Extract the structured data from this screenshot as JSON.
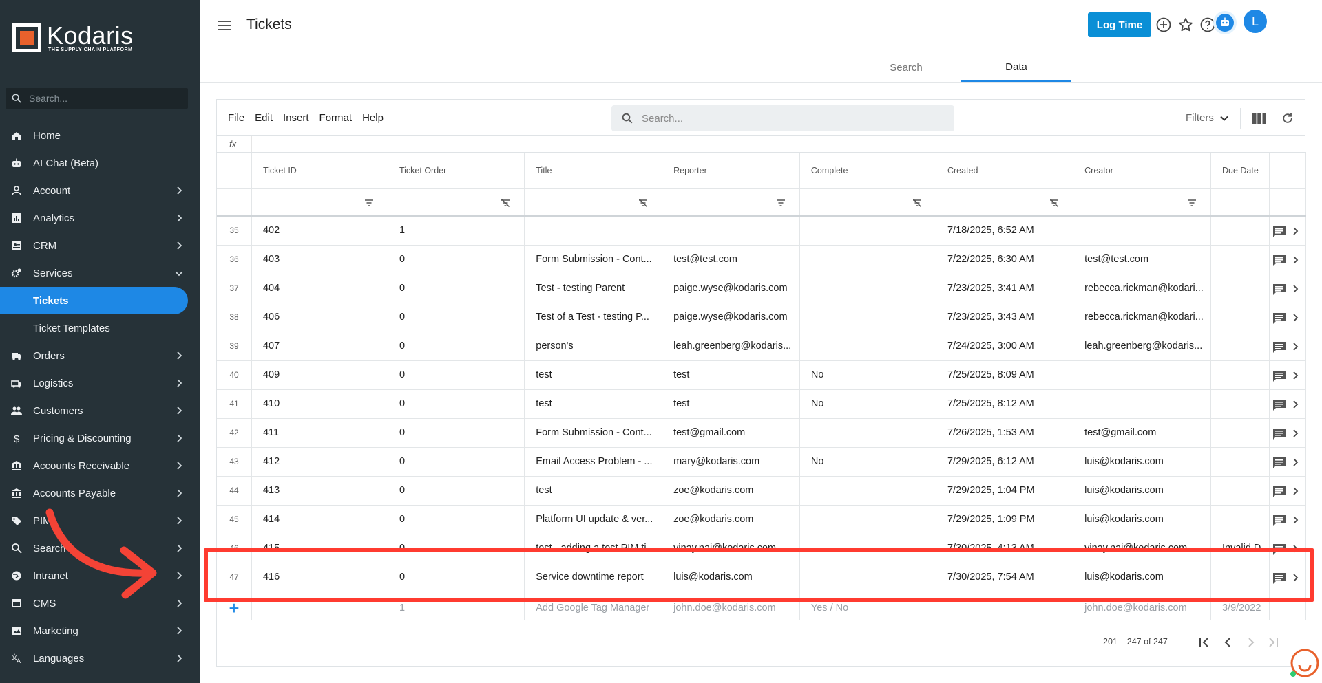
{
  "brand": {
    "name": "Kodaris",
    "tagline": "THE SUPPLY CHAIN PLATFORM"
  },
  "sidebar": {
    "search_placeholder": "Search...",
    "items": [
      {
        "label": "Home",
        "icon": "home-icon"
      },
      {
        "label": "AI Chat (Beta)",
        "icon": "robot-icon"
      },
      {
        "label": "Account",
        "icon": "person-icon"
      },
      {
        "label": "Analytics",
        "icon": "chart-icon"
      },
      {
        "label": "CRM",
        "icon": "contact-card-icon"
      },
      {
        "label": "Services",
        "icon": "gears-icon"
      },
      {
        "label": "Tickets",
        "icon": ""
      },
      {
        "label": "Ticket Templates",
        "icon": ""
      },
      {
        "label": "Orders",
        "icon": "truck-icon"
      },
      {
        "label": "Logistics",
        "icon": "shipping-icon"
      },
      {
        "label": "Customers",
        "icon": "people-icon"
      },
      {
        "label": "Pricing & Discounting",
        "icon": "dollar-icon"
      },
      {
        "label": "Accounts Receivable",
        "icon": "bank-icon"
      },
      {
        "label": "Accounts Payable",
        "icon": "bank-icon"
      },
      {
        "label": "PIM",
        "icon": "tag-icon"
      },
      {
        "label": "Search",
        "icon": "search-icon"
      },
      {
        "label": "Intranet",
        "icon": "globe-icon"
      },
      {
        "label": "CMS",
        "icon": "window-icon"
      },
      {
        "label": "Marketing",
        "icon": "photo-icon"
      },
      {
        "label": "Languages",
        "icon": "translate-icon"
      }
    ]
  },
  "header": {
    "title": "Tickets",
    "log_time_label": "Log Time",
    "avatar_initial": "L",
    "tabs": [
      {
        "label": "Search"
      },
      {
        "label": "Data"
      }
    ],
    "active_tab": "Data"
  },
  "toolbar": {
    "menu": [
      "File",
      "Edit",
      "Insert",
      "Format",
      "Help"
    ],
    "search_placeholder": "Search...",
    "filters_label": "Filters",
    "fx_label": "fx"
  },
  "table": {
    "columns": [
      "Ticket ID",
      "Ticket Order",
      "Title",
      "Reporter",
      "Complete",
      "Created",
      "Creator",
      "Due Date"
    ],
    "rows": [
      {
        "n": "35",
        "id": "402",
        "order": "1",
        "title": "",
        "reporter": "",
        "complete": "",
        "created": "7/18/2025, 6:52 AM",
        "creator": "",
        "due": ""
      },
      {
        "n": "36",
        "id": "403",
        "order": "0",
        "title": "Form Submission - Cont...",
        "reporter": "test@test.com",
        "complete": "",
        "created": "7/22/2025, 6:30 AM",
        "creator": "test@test.com",
        "due": ""
      },
      {
        "n": "37",
        "id": "404",
        "order": "0",
        "title": "Test - testing Parent",
        "reporter": "paige.wyse@kodaris.com",
        "complete": "",
        "created": "7/23/2025, 3:41 AM",
        "creator": "rebecca.rickman@kodari...",
        "due": ""
      },
      {
        "n": "38",
        "id": "406",
        "order": "0",
        "title": "Test of a Test - testing P...",
        "reporter": "paige.wyse@kodaris.com",
        "complete": "",
        "created": "7/23/2025, 3:43 AM",
        "creator": "rebecca.rickman@kodari...",
        "due": ""
      },
      {
        "n": "39",
        "id": "407",
        "order": "0",
        "title": "person's",
        "reporter": "leah.greenberg@kodaris...",
        "complete": "",
        "created": "7/24/2025, 3:00 AM",
        "creator": "leah.greenberg@kodaris...",
        "due": ""
      },
      {
        "n": "40",
        "id": "409",
        "order": "0",
        "title": "test",
        "reporter": "test",
        "complete": "No",
        "created": "7/25/2025, 8:09 AM",
        "creator": "",
        "due": ""
      },
      {
        "n": "41",
        "id": "410",
        "order": "0",
        "title": "test",
        "reporter": "test",
        "complete": "No",
        "created": "7/25/2025, 8:12 AM",
        "creator": "",
        "due": ""
      },
      {
        "n": "42",
        "id": "411",
        "order": "0",
        "title": "Form Submission - Cont...",
        "reporter": "test@gmail.com",
        "complete": "",
        "created": "7/26/2025, 1:53 AM",
        "creator": "test@gmail.com",
        "due": ""
      },
      {
        "n": "43",
        "id": "412",
        "order": "0",
        "title": "Email Access Problem - ...",
        "reporter": "mary@kodaris.com",
        "complete": "No",
        "created": "7/29/2025, 6:12 AM",
        "creator": "luis@kodaris.com",
        "due": ""
      },
      {
        "n": "44",
        "id": "413",
        "order": "0",
        "title": "test",
        "reporter": "zoe@kodaris.com",
        "complete": "",
        "created": "7/29/2025, 1:04 PM",
        "creator": "luis@kodaris.com",
        "due": ""
      },
      {
        "n": "45",
        "id": "414",
        "order": "0",
        "title": "Platform UI update & ver...",
        "reporter": "zoe@kodaris.com",
        "complete": "",
        "created": "7/29/2025, 1:09 PM",
        "creator": "luis@kodaris.com",
        "due": ""
      },
      {
        "n": "46",
        "id": "415",
        "order": "0",
        "title": "test - adding a test PIM ti...",
        "reporter": "vinay.nai@kodaris.com",
        "complete": "",
        "created": "7/30/2025, 4:13 AM",
        "creator": "vinay.nai@kodaris.com",
        "due": "Invalid D..."
      },
      {
        "n": "47",
        "id": "416",
        "order": "0",
        "title": "Service downtime report",
        "reporter": "luis@kodaris.com",
        "complete": "",
        "created": "7/30/2025, 7:54 AM",
        "creator": "luis@kodaris.com",
        "due": ""
      }
    ],
    "add_row": {
      "order": "1",
      "title": "Add Google Tag Manager",
      "reporter": "john.doe@kodaris.com",
      "complete": "Yes / No",
      "creator": "john.doe@kodaris.com",
      "due": "3/9/2022"
    }
  },
  "pager": {
    "range_text": "201 – 247 of 247"
  },
  "colors": {
    "sidebar_bg": "#263238",
    "accent": "#1e88e5",
    "log_time": "#0a8fd6",
    "highlight": "#ff3b30",
    "logo_orange": "#e8612c"
  }
}
